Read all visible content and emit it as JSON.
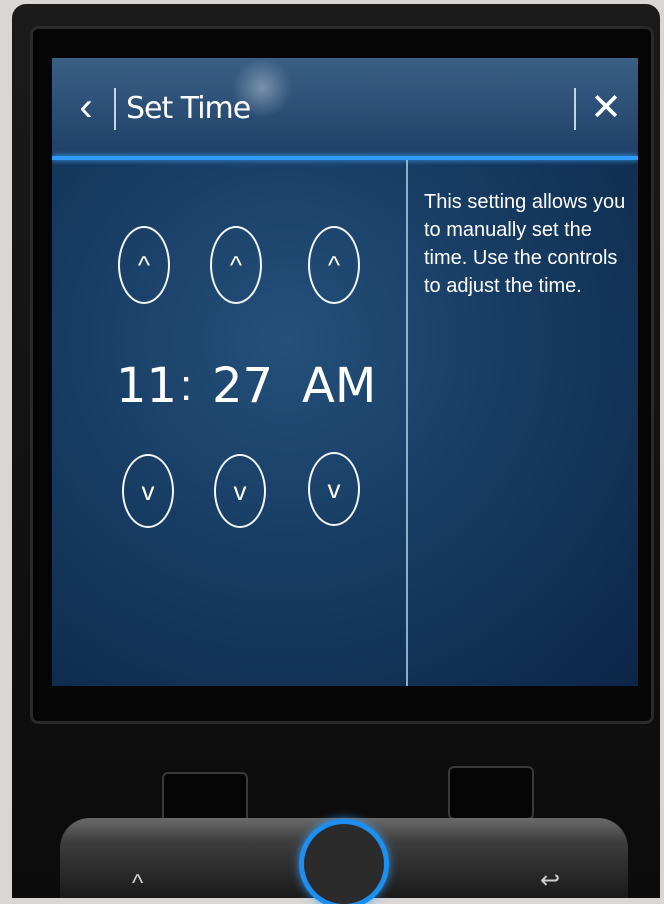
{
  "header": {
    "back_icon": "‹",
    "title": "Set Time",
    "close_icon": "✕"
  },
  "time": {
    "hour": "11",
    "separator": ":",
    "minute": "27",
    "period": "AM"
  },
  "controls": {
    "up_icon": "^",
    "down_icon": "v"
  },
  "help": {
    "text": "This setting allows you to manually set the time. Use the controls to adjust the time."
  },
  "colors": {
    "accent": "#2d9bff",
    "screen_bg": "#173c63"
  },
  "hardware": {
    "left_icon": "^",
    "right_icon": "↩"
  }
}
